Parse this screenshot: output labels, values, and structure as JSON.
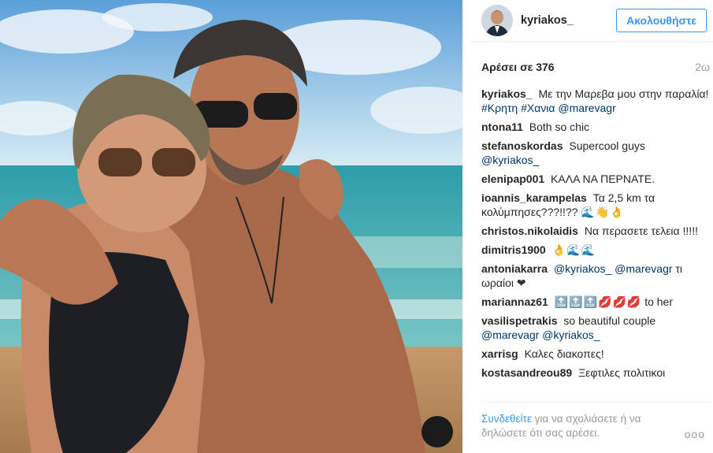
{
  "post": {
    "username": "kyriakos_",
    "follow_label": "Ακολουθήστε",
    "likes": "Αρέσει σε 376",
    "time": "2ω",
    "caption": {
      "user": "kyriakos_",
      "text": "Με την Μαρεβα μου στην παραλία!",
      "tags": [
        "#Κρητη",
        "#Χανια",
        "@marevagr"
      ]
    },
    "comments": [
      {
        "user": "ntona11",
        "text": "Both so chic"
      },
      {
        "user": "stefanoskordas",
        "text": "Supercool guys",
        "tag": "@kyriakos_"
      },
      {
        "user": "elenipap001",
        "text": "ΚΑΛΑ ΝΑ ΠΕΡΝΑΤΕ."
      },
      {
        "user": "ioannis_karampelas",
        "text": "Τα 2,5 km τα κολύμπησες???!!??",
        "emoji": "🌊👋👌"
      },
      {
        "user": "christos.nikolaidis",
        "text": "Να περασετε τελεια !!!!!"
      },
      {
        "user": "dimitris1900",
        "text": "",
        "emoji": "👌🌊🌊"
      },
      {
        "user": "antoniakarra",
        "text": "ωραίοι",
        "tags": [
          "@kyriakos_",
          "@marevagr",
          "τι"
        ],
        "emoji": "❤"
      },
      {
        "user": "mariannaz61",
        "text": "to her",
        "emoji": "🔝🔝🔝💋💋💋"
      },
      {
        "user": "vasilispetrakis",
        "text": "so beautiful couple",
        "tags": [
          "@marevagr",
          "@kyriakos_"
        ]
      },
      {
        "user": "xarrisg",
        "text": "Καλες διακοπες!"
      },
      {
        "user": "kostasandreou89",
        "text": "Ξεφτιλες πολιτικοι"
      }
    ],
    "login_link": "Συνδεθείτε",
    "login_text": "για να σχολιάσετε ή να δηλώσετε ότι σας αρέσει.",
    "more_label": "ooo"
  }
}
